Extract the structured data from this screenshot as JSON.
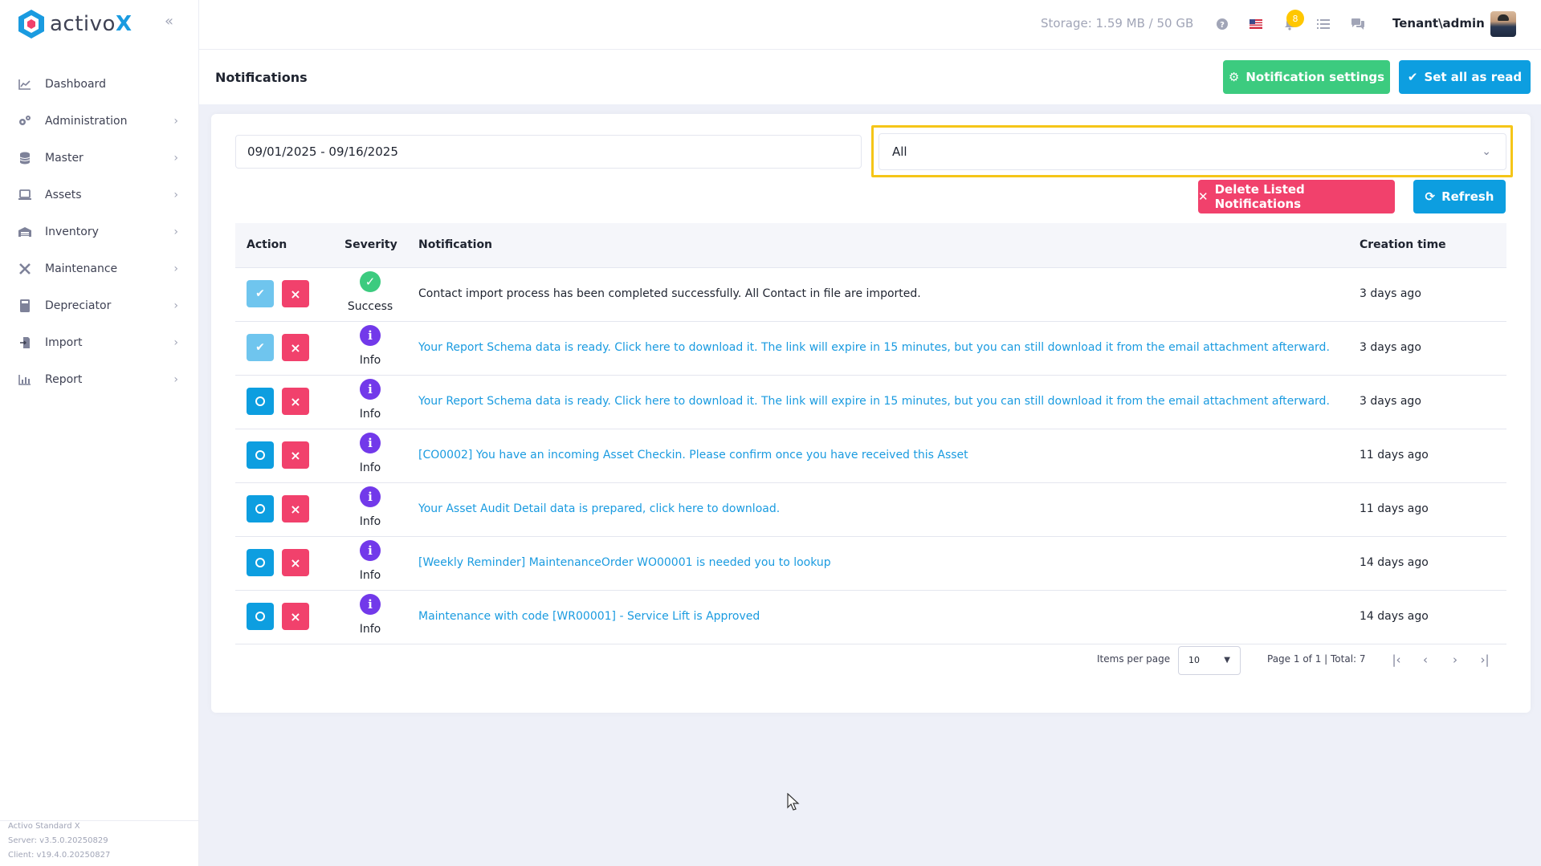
{
  "app": {
    "brand_prefix": "activo",
    "brand_suffix": "X",
    "version_lines": [
      "Activo Standard X",
      "Server: v3.5.0.20250829",
      "Client: v19.4.0.20250827"
    ]
  },
  "sidebar": {
    "items": [
      {
        "label": "Dashboard",
        "icon": "chart-line-icon",
        "has_children": false
      },
      {
        "label": "Administration",
        "icon": "cogs-icon",
        "has_children": true
      },
      {
        "label": "Master",
        "icon": "database-icon",
        "has_children": true
      },
      {
        "label": "Assets",
        "icon": "laptop-icon",
        "has_children": true
      },
      {
        "label": "Inventory",
        "icon": "warehouse-icon",
        "has_children": true
      },
      {
        "label": "Maintenance",
        "icon": "tools-icon",
        "has_children": true
      },
      {
        "label": "Depreciator",
        "icon": "calculator-icon",
        "has_children": true
      },
      {
        "label": "Import",
        "icon": "file-import-icon",
        "has_children": true
      },
      {
        "label": "Report",
        "icon": "bar-chart-icon",
        "has_children": true
      }
    ]
  },
  "topbar": {
    "storage": "Storage: 1.59 MB / 50 GB",
    "notification_count": "8",
    "user": "Tenant\\admin"
  },
  "page": {
    "title": "Notifications",
    "notification_settings": "Notification settings",
    "set_all_read": "Set all as read"
  },
  "filters": {
    "date_range": "09/01/2025 - 09/16/2025",
    "severity": "All",
    "delete_label": "Delete Listed Notifications",
    "refresh_label": "Refresh"
  },
  "table": {
    "headers": {
      "action": "Action",
      "severity": "Severity",
      "notification": "Notification",
      "creation_time": "Creation time"
    },
    "rows": [
      {
        "read": true,
        "severity": "Success",
        "text": "Contact import process has been completed successfully. All Contact in file are imported.",
        "is_link": false,
        "time": "3 days ago"
      },
      {
        "read": true,
        "severity": "Info",
        "text": "Your Report Schema data is ready. Click here to download it. The link will expire in 15 minutes, but you can still download it from the email attachment afterward.",
        "is_link": true,
        "time": "3 days ago"
      },
      {
        "read": false,
        "severity": "Info",
        "text": "Your Report Schema data is ready. Click here to download it. The link will expire in 15 minutes, but you can still download it from the email attachment afterward.",
        "is_link": true,
        "time": "3 days ago"
      },
      {
        "read": false,
        "severity": "Info",
        "text": "[CO0002] You have an incoming Asset Checkin. Please confirm once you have received this Asset",
        "is_link": true,
        "time": "11 days ago"
      },
      {
        "read": false,
        "severity": "Info",
        "text": "Your Asset Audit Detail data is prepared, click here to download.",
        "is_link": true,
        "time": "11 days ago"
      },
      {
        "read": false,
        "severity": "Info",
        "text": "[Weekly Reminder] MaintenanceOrder WO00001 is needed you to lookup",
        "is_link": true,
        "time": "14 days ago"
      },
      {
        "read": false,
        "severity": "Info",
        "text": "Maintenance with code [WR00001] - Service Lift is Approved",
        "is_link": true,
        "time": "14 days ago"
      }
    ]
  },
  "pagination": {
    "items_per_page_label": "Items per page",
    "items_per_page": "10",
    "page_info": "Page 1 of 1 | Total: 7"
  },
  "colors": {
    "primary": "#0d9ee0",
    "success": "#3ccb7f",
    "danger": "#f1416c",
    "info": "#7239ea",
    "highlight": "#f5c518",
    "badge": "#ffc700"
  }
}
